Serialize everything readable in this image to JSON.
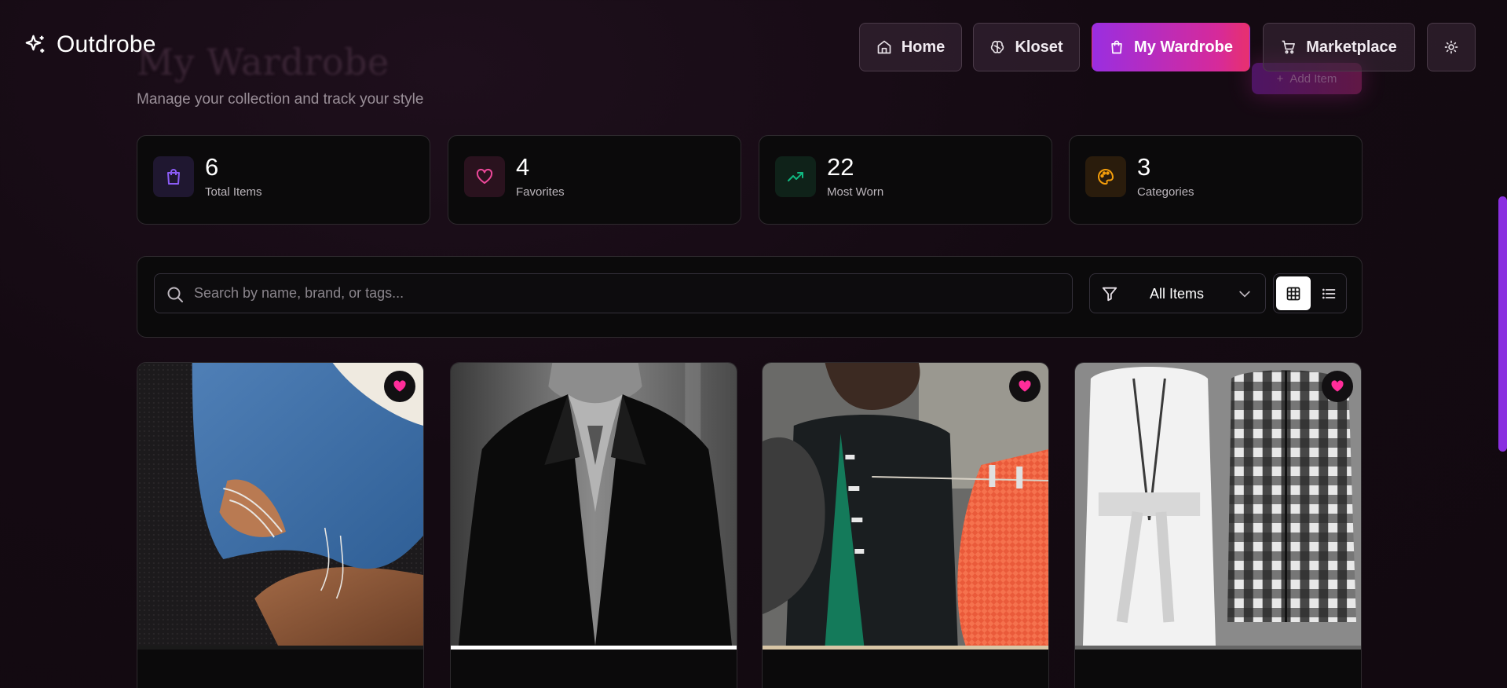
{
  "brand": {
    "name": "Outdrobe"
  },
  "nav": {
    "items": [
      {
        "label": "Home",
        "icon": "home-icon"
      },
      {
        "label": "Kloset",
        "icon": "brain-icon"
      },
      {
        "label": "My Wardrobe",
        "icon": "shopping-bag-icon",
        "active": true
      },
      {
        "label": "Marketplace",
        "icon": "shopping-cart-icon"
      }
    ],
    "theme_toggle_icon": "sun-icon"
  },
  "page": {
    "title": "My Wardrobe",
    "subtitle": "Manage your collection and track your style",
    "add_button_label": "Add Item"
  },
  "stats": [
    {
      "value": "6",
      "label": "Total Items",
      "icon": "shopping-bag-icon",
      "color": "#8b5cf6"
    },
    {
      "value": "4",
      "label": "Favorites",
      "icon": "heart-icon",
      "color": "#ec4899"
    },
    {
      "value": "22",
      "label": "Most Worn",
      "icon": "trending-up-icon",
      "color": "#10b981"
    },
    {
      "value": "3",
      "label": "Categories",
      "icon": "palette-icon",
      "color": "#f59e0b"
    }
  ],
  "toolbar": {
    "search_placeholder": "Search by name, brand, or tags...",
    "search_value": "",
    "filter_selected": "All Items",
    "view_mode": "grid"
  },
  "items": [
    {
      "favorite": true
    },
    {
      "favorite": false
    },
    {
      "favorite": true
    },
    {
      "favorite": true
    }
  ],
  "colors": {
    "accent_gradient_start": "#9a2ee0",
    "accent_gradient_end": "#e8306e",
    "favorite": "#ff2d9a"
  }
}
